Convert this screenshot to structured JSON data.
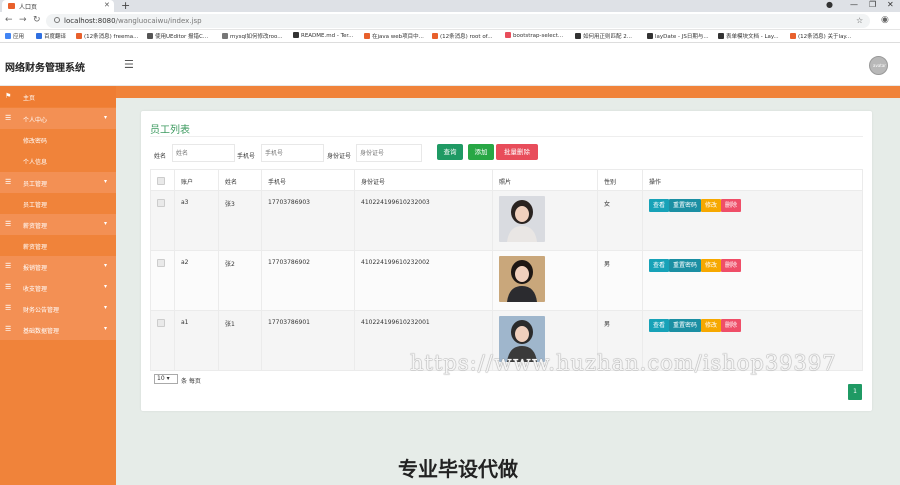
{
  "browser": {
    "tab_title": "人口页",
    "url_host": "localhost:8080",
    "url_path": "/wangluocaiwu/index.jsp",
    "bookmarks": [
      "应用",
      "百度翻译",
      "(12条消息) freema...",
      "使用UEditor 报错C...",
      "mysql如何修改roo...",
      "README.md - Ter...",
      "在java web项目中...",
      "(12条消息) root of...",
      "bootstrap-select...",
      "如何用正则匹配 2...",
      "layDate - JS日期与...",
      "表单模块文档 - Lay...",
      "(12条消息) 关于lay..."
    ]
  },
  "header": {
    "logo": "网络财务管理系统",
    "avatar_text": "avatar"
  },
  "sidebar": {
    "items": [
      {
        "label": "主页",
        "type": "first"
      },
      {
        "label": "个人中心",
        "type": "parent"
      },
      {
        "label": "修改密码",
        "type": "child"
      },
      {
        "label": "个人信息",
        "type": "child"
      },
      {
        "label": "员工管理",
        "type": "parent"
      },
      {
        "label": "员工管理",
        "type": "child"
      },
      {
        "label": "薪资管理",
        "type": "parent"
      },
      {
        "label": "薪资管理",
        "type": "child"
      },
      {
        "label": "报销管理",
        "type": "parent"
      },
      {
        "label": "收支管理",
        "type": "parent"
      },
      {
        "label": "财务公告管理",
        "type": "parent"
      },
      {
        "label": "基础数据管理",
        "type": "parent"
      }
    ]
  },
  "main": {
    "title": "员工列表",
    "search": {
      "name_label": "姓名",
      "name_placeholder": "姓名",
      "phone_label": "手机号",
      "phone_placeholder": "手机号",
      "id_label": "身份证号",
      "id_placeholder": "身份证号"
    },
    "buttons": {
      "query": "查询",
      "add": "添加",
      "batch_delete": "批量删除"
    },
    "table": {
      "headers": [
        "",
        "账户",
        "姓名",
        "手机号",
        "身份证号",
        "照片",
        "性别",
        "操作"
      ],
      "rows": [
        {
          "account": "a3",
          "name": "张3",
          "phone": "17703786903",
          "id_card": "410224199610232003",
          "gender": "女"
        },
        {
          "account": "a2",
          "name": "张2",
          "phone": "17703786902",
          "id_card": "410224199610232002",
          "gender": "男"
        },
        {
          "account": "a1",
          "name": "张1",
          "phone": "17703786901",
          "id_card": "410224199610232001",
          "gender": "男"
        }
      ],
      "actions": {
        "view": "查看",
        "reset": "重置密码",
        "edit": "修改",
        "delete": "删除"
      }
    },
    "pager": {
      "page_size": "10",
      "per_page_text": "条 每页",
      "current_page": "1"
    }
  },
  "overlay": {
    "watermark": "https://www.huzhan.com/ishop39397",
    "promo": "专业毕设代做"
  }
}
